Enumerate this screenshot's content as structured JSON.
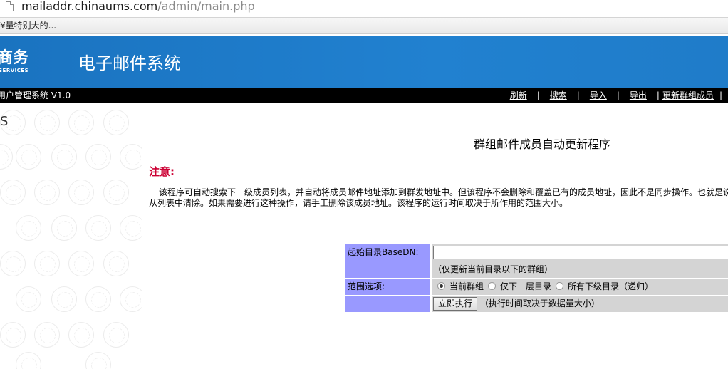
{
  "browser": {
    "url_host": "mailaddr.chinaums.com",
    "url_path": "/admin/main.php",
    "status_text": "¥量特别大的..."
  },
  "banner": {
    "logo_main": "商务",
    "logo_sub": "SERVICES",
    "system_title": "电子邮件系统"
  },
  "navbar": {
    "version": "用户管理系统 V1.0",
    "links": [
      "刷新",
      "搜索",
      "导入",
      "导出",
      "更新群组成员"
    ],
    "separator": "|"
  },
  "sidebar": {
    "letter": "S"
  },
  "content": {
    "title": "群组邮件成员自动更新程序",
    "notice_label": "注意:",
    "notice_line1": "该程序可自动搜索下一级成员列表，并自动将成员邮件地址添加到群发地址中。但该程序不会删除和覆盖已有的成员地址，因此不是同步操作。也就是说",
    "notice_line2": "从列表中清除。如果需要进行这种操作，请手工删除该成员地址。该程序的运行时间取决于所作用的范围大小。"
  },
  "form": {
    "basedn_label": "起始目录BaseDN:",
    "basedn_value": "",
    "basedn_hint": "（仅更新当前目录以下的群组）",
    "scope_label": "范围选项:",
    "scope_options": [
      "当前群组",
      "仅下一层目录",
      "所有下级目录（递归）"
    ],
    "scope_selected": "当前群组",
    "run_button": "立即执行",
    "run_hint": "（执行时间取决于数据量大小）"
  }
}
